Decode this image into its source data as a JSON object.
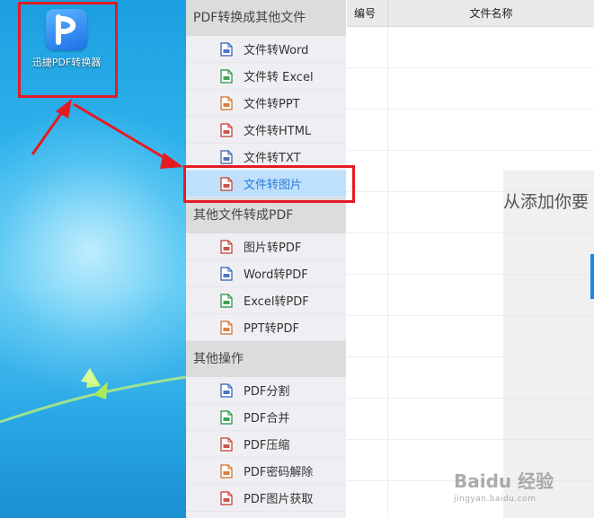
{
  "desktop": {
    "icon_label": "迅捷PDF转换器"
  },
  "menu": {
    "sections": [
      {
        "title": "PDF转换成其他文件",
        "items": [
          {
            "label": "文件转Word",
            "icon": "word-file-icon",
            "color": "#2b5fb4"
          },
          {
            "label": "文件转 Excel",
            "icon": "excel-file-icon",
            "color": "#1f8f3a"
          },
          {
            "label": "文件转PPT",
            "icon": "ppt-file-icon",
            "color": "#d06c22"
          },
          {
            "label": "文件转HTML",
            "icon": "html-file-icon",
            "color": "#c0392b"
          },
          {
            "label": "文件转TXT",
            "icon": "txt-file-icon",
            "color": "#3b5ea8"
          },
          {
            "label": "文件转图片",
            "icon": "image-file-icon",
            "color": "#c0392b",
            "active": true
          }
        ]
      },
      {
        "title": "其他文件转成PDF",
        "items": [
          {
            "label": "图片转PDF",
            "icon": "image-file-icon",
            "color": "#c0392b"
          },
          {
            "label": "Word转PDF",
            "icon": "word-file-icon",
            "color": "#2b5fb4"
          },
          {
            "label": "Excel转PDF",
            "icon": "excel-file-icon",
            "color": "#1f8f3a"
          },
          {
            "label": "PPT转PDF",
            "icon": "ppt-file-icon",
            "color": "#d06c22"
          }
        ]
      },
      {
        "title": "其他操作",
        "items": [
          {
            "label": "PDF分割",
            "icon": "pdf-split-icon",
            "color": "#2b5fb4"
          },
          {
            "label": "PDF合并",
            "icon": "pdf-merge-icon",
            "color": "#1f8f3a"
          },
          {
            "label": "PDF压缩",
            "icon": "pdf-compress-icon",
            "color": "#c0392b"
          },
          {
            "label": "PDF密码解除",
            "icon": "pdf-unlock-icon",
            "color": "#d06c22"
          },
          {
            "label": "PDF图片获取",
            "icon": "pdf-image-extract-icon",
            "color": "#c0392b"
          }
        ]
      }
    ]
  },
  "table": {
    "col_number": "编号",
    "col_filename": "文件名称"
  },
  "drop_hint": "从添加你要",
  "watermark": {
    "main": "Baidu 经验",
    "sub": "jingyan.baidu.com"
  },
  "colors": {
    "highlight": "#e51b24",
    "active_bg": "#bfe0fb",
    "active_text": "#2a7bd8"
  }
}
